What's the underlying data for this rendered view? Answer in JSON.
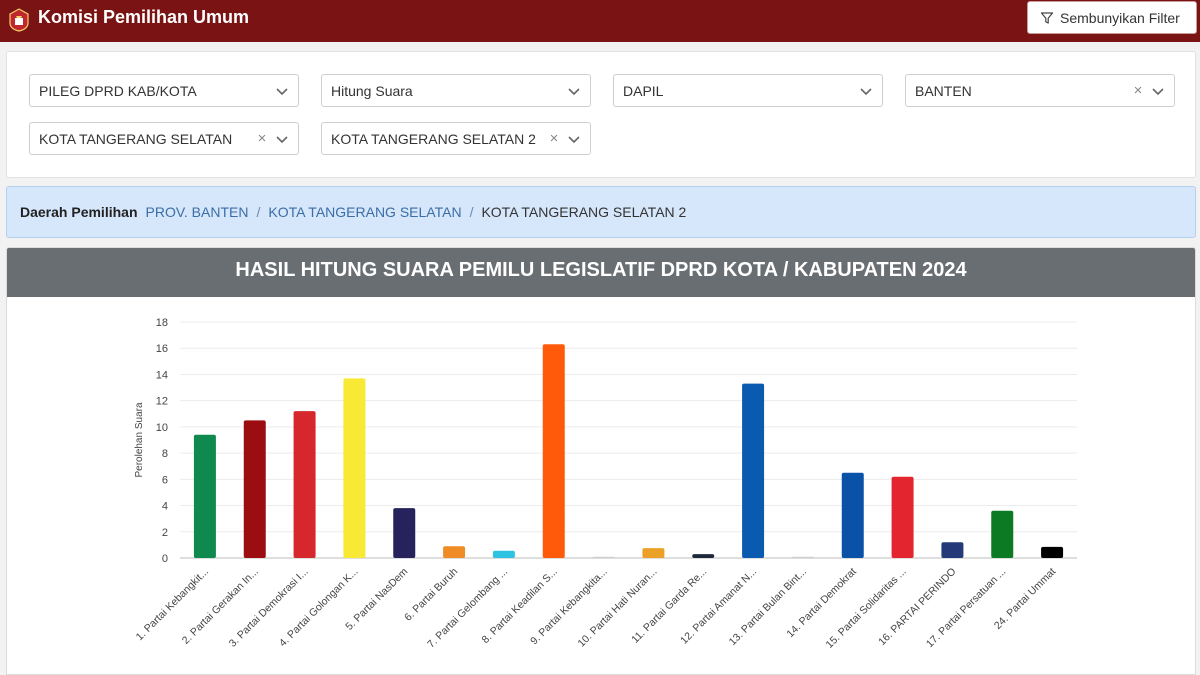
{
  "app": {
    "title": "Komisi Pemilihan Umum",
    "filter_button_label": "Sembunyikan Filter"
  },
  "filters": [
    {
      "value": "PILEG DPRD KAB/KOTA",
      "clearable": false
    },
    {
      "value": "Hitung Suara",
      "clearable": false
    },
    {
      "value": "DAPIL",
      "clearable": false
    },
    {
      "value": "BANTEN",
      "clearable": true
    },
    {
      "value": "KOTA TANGERANG SELATAN",
      "clearable": true
    },
    {
      "value": "KOTA TANGERANG SELATAN 2",
      "clearable": true
    }
  ],
  "breadcrumb": {
    "label": "Daerah Pemilihan",
    "items": [
      "PROV. BANTEN",
      "KOTA TANGERANG SELATAN"
    ],
    "separator": "/",
    "current": "KOTA TANGERANG SELATAN 2"
  },
  "colors": {
    "brand": "#7a1313",
    "header_gray": "#696e72",
    "breadcrumb_bg": "#d6e6fb",
    "link": "#3a6ea5"
  },
  "chart_data": {
    "type": "bar",
    "title": "HASIL HITUNG SUARA PEMILU LEGISLATIF DPRD KOTA / KABUPATEN 2024",
    "xlabel": "",
    "ylabel": "Perolehan Suara",
    "ylim": [
      0,
      18
    ],
    "yticks": [
      0,
      2,
      4,
      6,
      8,
      10,
      12,
      14,
      16,
      18
    ],
    "grid": true,
    "legend": "none",
    "categories": [
      "1. Partai Kebangkit...",
      "2. Partai Gerakan In...",
      "3. Partai Demokrasi I...",
      "4. Partai Golongan K...",
      "5. Partai NasDem",
      "6. Partai Buruh",
      "7. Partai Gelombang ...",
      "8. Partai Keadilan S...",
      "9. Partai Kebangkita...",
      "10. Partai Hati Nuran...",
      "11. Partai Garda Re...",
      "12. Partai Amanat N...",
      "13. Partai Bulan Bint...",
      "14. Partai Demokrat",
      "15. Partai Solidaritas ...",
      "16. PARTAI PERINDO",
      "17. Partai Persatuan ...",
      "24. Partai Ummat"
    ],
    "values": [
      9.4,
      10.5,
      11.2,
      13.7,
      3.8,
      0.9,
      0.55,
      16.3,
      0.1,
      0.75,
      0.3,
      13.3,
      0.1,
      6.5,
      6.2,
      1.2,
      3.6,
      0.85
    ],
    "bar_colors": [
      "#0e8a4f",
      "#9b0d11",
      "#d6272d",
      "#f7e934",
      "#26225c",
      "#f08c26",
      "#2fc3e3",
      "#ff5a0a",
      "#cfcfcf",
      "#eba027",
      "#1e2a3c",
      "#0a5bb0",
      "#cfcfcf",
      "#0a52a8",
      "#e3252f",
      "#243a78",
      "#0b7a22",
      "#000000"
    ]
  }
}
